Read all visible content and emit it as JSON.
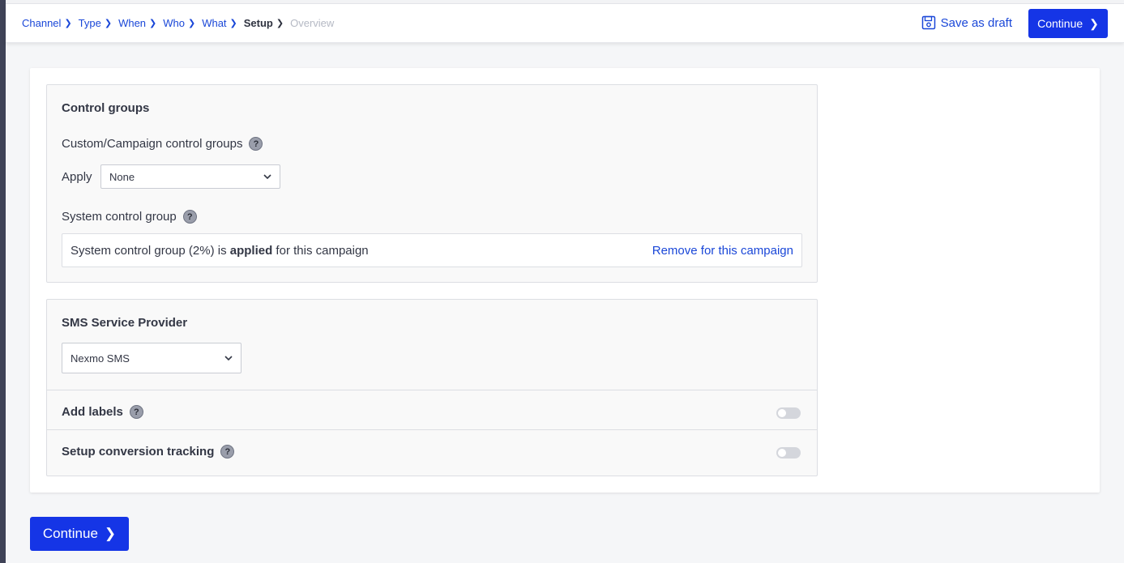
{
  "breadcrumb": [
    {
      "label": "Channel",
      "state": "link"
    },
    {
      "label": "Type",
      "state": "link"
    },
    {
      "label": "When",
      "state": "link"
    },
    {
      "label": "Who",
      "state": "link"
    },
    {
      "label": "What",
      "state": "link"
    },
    {
      "label": "Setup",
      "state": "active"
    },
    {
      "label": "Overview",
      "state": "disabled"
    }
  ],
  "header": {
    "save_draft_label": "Save as draft",
    "continue_label": "Continue"
  },
  "control_groups": {
    "title": "Control groups",
    "custom_label": "Custom/Campaign control groups",
    "apply_label": "Apply",
    "apply_value": "None",
    "system_label": "System control group",
    "system_text_pre": "System control group (2%) is ",
    "system_text_bold": "applied",
    "system_text_post": " for this campaign",
    "remove_link": "Remove for this campaign"
  },
  "sms": {
    "title": "SMS Service Provider",
    "provider_value": "Nexmo SMS",
    "add_labels": "Add labels",
    "add_labels_enabled": false,
    "conversion_tracking": "Setup conversion tracking",
    "conversion_tracking_enabled": false
  },
  "footer": {
    "continue_label": "Continue"
  },
  "colors": {
    "primary": "#1535e6",
    "link": "#1a47d8",
    "text": "#333745",
    "disabled": "#b5b9c4"
  }
}
